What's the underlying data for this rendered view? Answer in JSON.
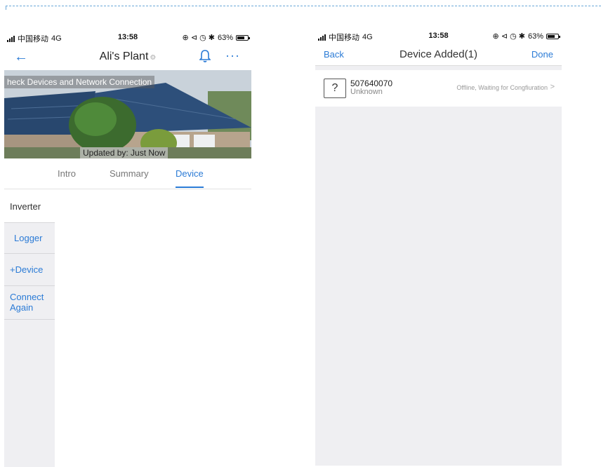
{
  "status_bar": {
    "carrier": "中国移动",
    "network": "4G",
    "time": "13:58",
    "battery": "63%",
    "indicators": "⊕ ⊲ ◷ ✱"
  },
  "left": {
    "nav": {
      "back_icon": "←",
      "title": "Ali's Plant",
      "title_icon": "⚙",
      "more_icon": "···"
    },
    "banner": {
      "message": "heck Devices and Network Connection",
      "updated": "Updated by: Just Now"
    },
    "tabs": [
      {
        "label": "Intro"
      },
      {
        "label": "Summary"
      },
      {
        "label": "Device"
      }
    ],
    "side_menu": [
      {
        "label": "Inverter"
      },
      {
        "label": "Logger"
      },
      {
        "label": "+Device"
      },
      {
        "label": "Connect Again"
      }
    ]
  },
  "right": {
    "nav": {
      "back": "Back",
      "title": "Device Added(1)",
      "done": "Done"
    },
    "device": {
      "icon": "?",
      "id": "507640070",
      "type": "Unknown",
      "status": "Offline, Waiting for Congfiuration",
      "chevron": ">"
    }
  },
  "colors": {
    "accent": "#2b7bd6",
    "panel_bg": "#efeff2",
    "divider": "#6aa7d8"
  }
}
